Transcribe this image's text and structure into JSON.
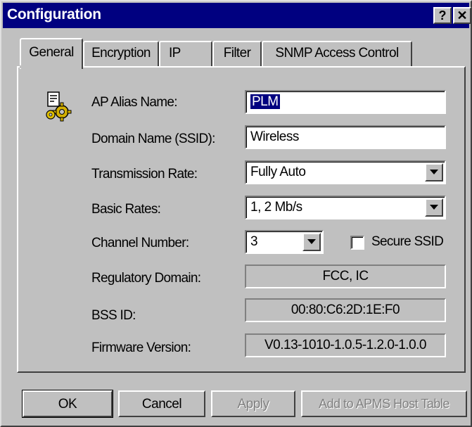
{
  "window": {
    "title": "Configuration",
    "help_label": "?",
    "close_label": "✕"
  },
  "tabs": [
    {
      "label": "General",
      "active": true
    },
    {
      "label": "Encryption",
      "active": false
    },
    {
      "label": "IP",
      "active": false
    },
    {
      "label": "Filter",
      "active": false
    },
    {
      "label": "SNMP Access Control",
      "active": false
    }
  ],
  "general": {
    "icon": "gear-settings-icon",
    "ap_alias_label": "AP Alias Name:",
    "ap_alias_value": "PLM",
    "domain_name_label": "Domain Name (SSID):",
    "domain_name_value": "Wireless",
    "transmission_rate_label": "Transmission Rate:",
    "transmission_rate_value": "Fully Auto",
    "basic_rates_label": "Basic Rates:",
    "basic_rates_value": "1, 2 Mb/s",
    "channel_label": "Channel Number:",
    "channel_value": "3",
    "secure_ssid_label": "Secure SSID",
    "secure_ssid_checked": false,
    "regulatory_label": "Regulatory Domain:",
    "regulatory_value": "FCC, IC",
    "bssid_label": "BSS ID:",
    "bssid_value": "00:80:C6:2D:1E:F0",
    "firmware_label": "Firmware Version:",
    "firmware_value": "V0.13-1010-1.0.5-1.2.0-1.0.0"
  },
  "buttons": {
    "ok": "OK",
    "cancel": "Cancel",
    "apply": "Apply",
    "add_apms": "Add to APMS Host Table"
  },
  "colors": {
    "titlebar": "#000080",
    "dialog_bg": "#c0c0c0",
    "selection": "#000080"
  }
}
